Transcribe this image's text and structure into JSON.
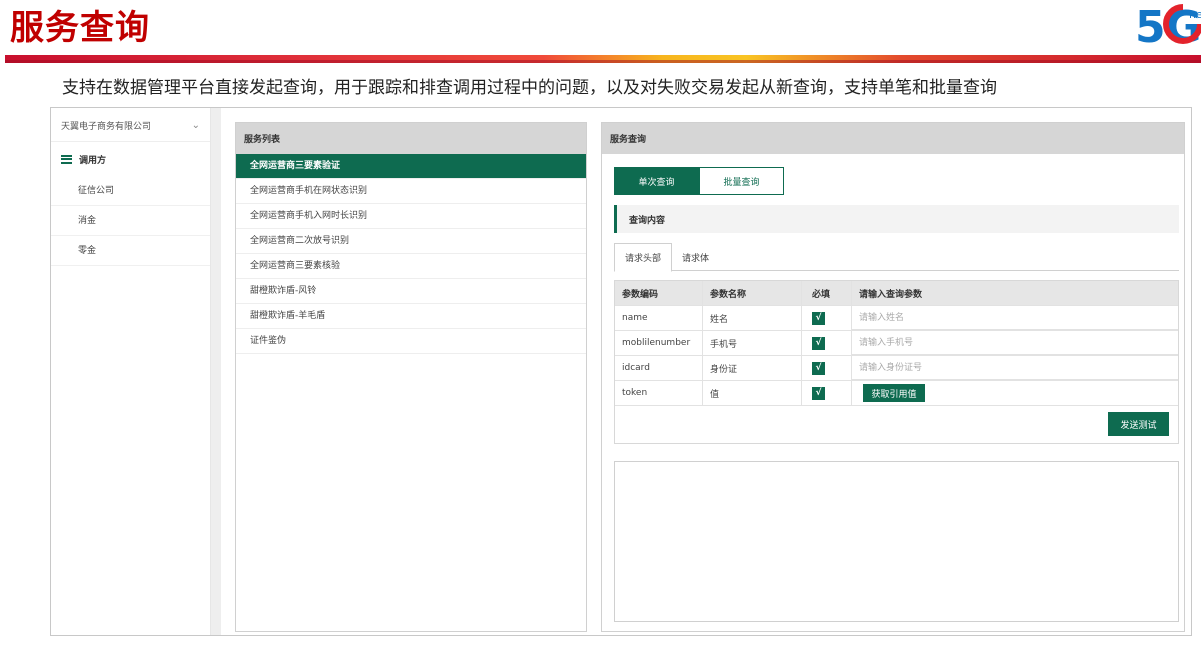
{
  "slide": {
    "title": "服务查询",
    "subtitle": "支持在数据管理平台直接发起查询，用于跟踪和排查调用过程中的问题，以及对失败交易发起从新查询，支持单笔和批量查询",
    "logo_text": "5G",
    "logo_suffix": "he"
  },
  "nav": {
    "company": "天翼电子商务有限公司",
    "group_label": "调用方",
    "items": [
      "征信公司",
      "消金",
      "零金"
    ]
  },
  "service_list": {
    "header": "服务列表",
    "items": [
      "全网运营商三要素验证",
      "全网运营商手机在网状态识别",
      "全网运营商手机入网时长识别",
      "全网运营商二次放号识别",
      "全网运营商三要素核验",
      "甜橙欺诈盾-风铃",
      "甜橙欺诈盾-羊毛盾",
      "证件鉴伪"
    ],
    "active_index": 0
  },
  "query": {
    "header": "服务查询",
    "mode_tabs": [
      "单次查询",
      "批量查询"
    ],
    "section_title": "查询内容",
    "sub_tabs": [
      "请求头部",
      "请求体"
    ],
    "table": {
      "headers": [
        "参数编码",
        "参数名称",
        "必填",
        "请输入查询参数"
      ],
      "rows": [
        {
          "code": "name",
          "name": "姓名",
          "required": "√",
          "placeholder": "请输入姓名"
        },
        {
          "code": "moblilenumber",
          "name": "手机号",
          "required": "√",
          "placeholder": "请输入手机号"
        },
        {
          "code": "idcard",
          "name": "身份证",
          "required": "√",
          "placeholder": "请输入身份证号"
        },
        {
          "code": "token",
          "name": "值",
          "required": "√",
          "button": "获取引用值"
        }
      ]
    },
    "send_button": "发送测试"
  },
  "colors": {
    "accent": "#0e6b50",
    "title_red": "#c00000",
    "logo_blue": "#1476c6",
    "logo_red": "#e3232c"
  }
}
